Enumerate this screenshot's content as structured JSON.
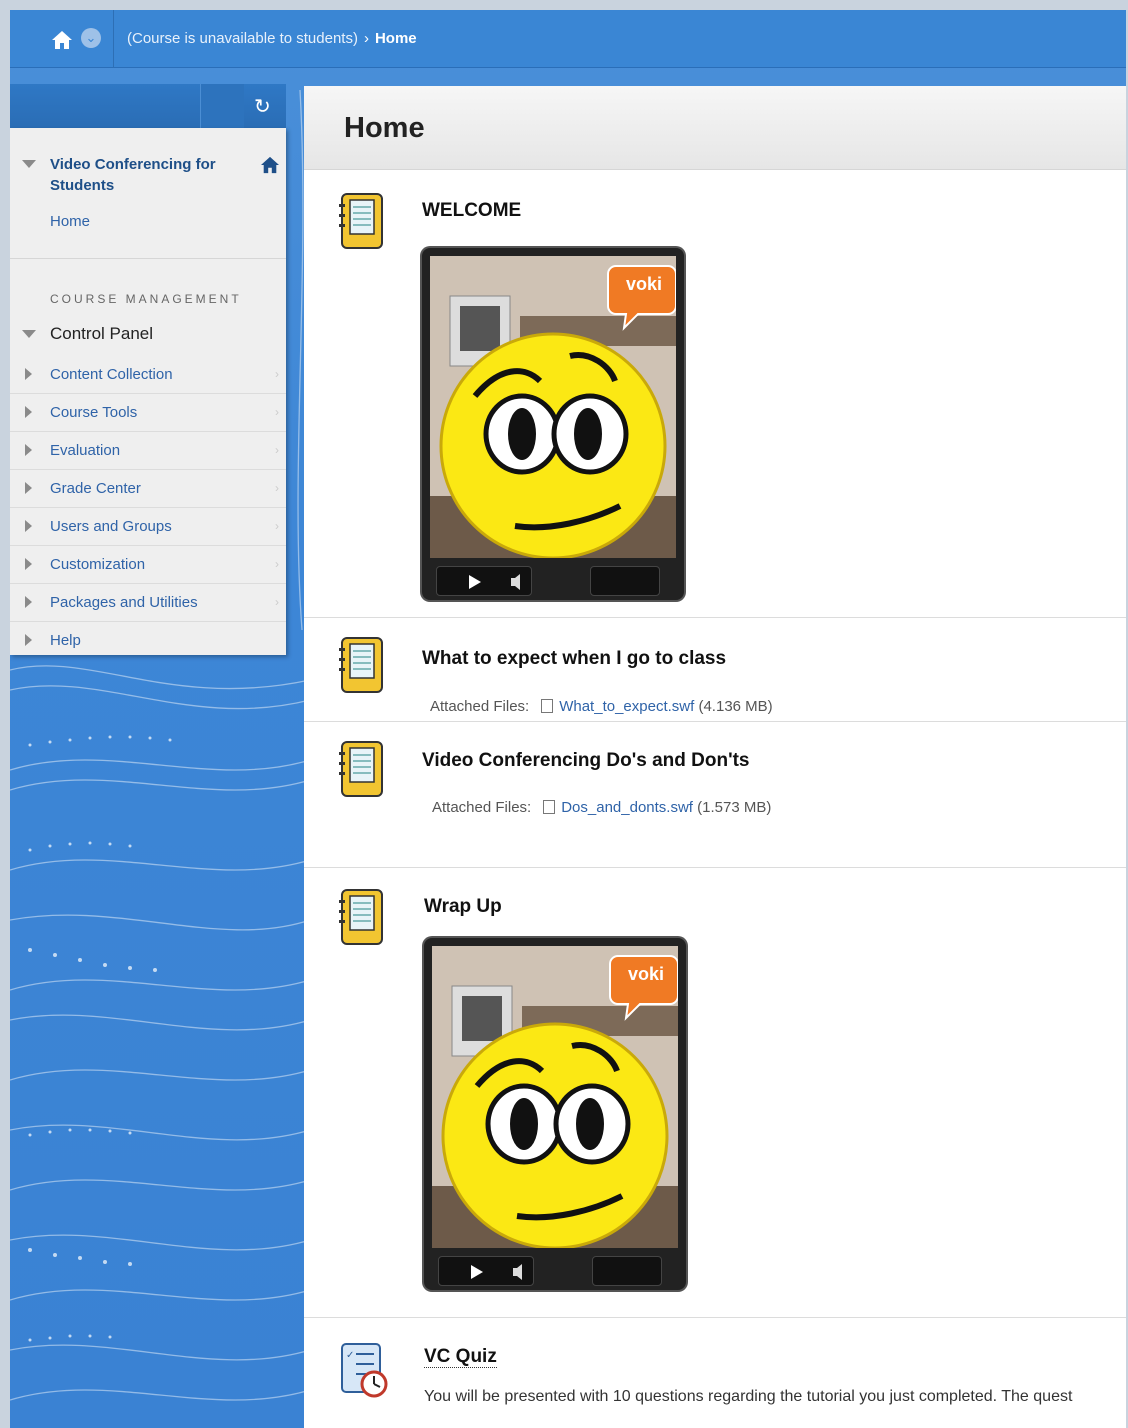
{
  "breadcrumb": {
    "course_status": "(Course is unavailable to students)",
    "separator": "›",
    "current": "Home"
  },
  "menu": {
    "course_title": "Video Conferencing for Students",
    "home_link": "Home",
    "section_label": "COURSE MANAGEMENT",
    "control_panel_label": "Control Panel",
    "items": [
      {
        "label": "Content Collection"
      },
      {
        "label": "Course Tools"
      },
      {
        "label": "Evaluation"
      },
      {
        "label": "Grade Center"
      },
      {
        "label": "Users and Groups"
      },
      {
        "label": "Customization"
      },
      {
        "label": "Packages and Utilities"
      },
      {
        "label": "Help"
      }
    ]
  },
  "page": {
    "title": "Home"
  },
  "content_items": [
    {
      "title": "WELCOME",
      "type": "voki",
      "brand": "voki"
    },
    {
      "title": "What to expect when I go to class",
      "attached_label": "Attached Files:",
      "file_name": "What_to_expect.swf",
      "file_size": "(4.136 MB)"
    },
    {
      "title": "Video Conferencing Do's and Don'ts",
      "attached_label": "Attached Files:",
      "file_name": "Dos_and_donts.swf",
      "file_size": "(1.573 MB)"
    },
    {
      "title": "Wrap Up",
      "type": "voki",
      "brand": "voki"
    },
    {
      "title": "VC Quiz",
      "description": "You will be presented with 10 questions regarding the tutorial you just completed. The quest"
    }
  ],
  "colors": {
    "accent_blue": "#3a86d4",
    "link_blue": "#2f63a8",
    "menu_bg": "#efefef"
  }
}
